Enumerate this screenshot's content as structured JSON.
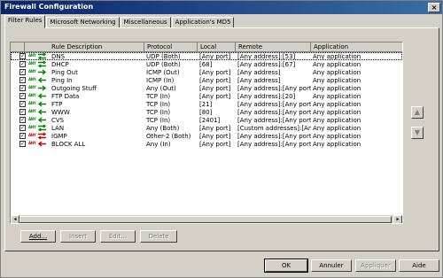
{
  "window": {
    "title": "Firewall Configuration",
    "close_glyph": "×"
  },
  "tabs": [
    {
      "label": "Filter Rules",
      "active": true
    },
    {
      "label": "Microsoft Networking",
      "active": false
    },
    {
      "label": "Miscellaneous",
      "active": false
    },
    {
      "label": "Application's MD5",
      "active": false
    }
  ],
  "columns": [
    "Rule Description",
    "Protocol",
    "Local",
    "Remote",
    "Application"
  ],
  "rules": [
    {
      "enabled": true,
      "dir": "both",
      "desc": "DNS",
      "protocol": "UDP (Both)",
      "local": "[Any port]",
      "remote": "[Any address]:[53]",
      "app": "Any application",
      "selected": true
    },
    {
      "enabled": true,
      "dir": "both",
      "desc": "DHCP",
      "protocol": "UDP (Both)",
      "local": "[68]",
      "remote": "[Any address]:[67]",
      "app": "Any application"
    },
    {
      "enabled": true,
      "dir": "out",
      "desc": "Ping Out",
      "protocol": "ICMP (Out)",
      "local": "[Any port]",
      "remote": "[Any address]",
      "app": "Any application"
    },
    {
      "enabled": true,
      "dir": "in",
      "desc": "Ping In",
      "protocol": "ICMP (In)",
      "local": "[Any port]",
      "remote": "[Any address]",
      "app": "Any application"
    },
    {
      "enabled": true,
      "dir": "out",
      "desc": "Outgoing Stuff",
      "protocol": "Any (Out)",
      "local": "[Any port]",
      "remote": "[Any address]:[Any port]",
      "app": "Any application"
    },
    {
      "enabled": true,
      "dir": "in",
      "desc": "FTP Data",
      "protocol": "TCP (In)",
      "local": "[Any port]",
      "remote": "[Any address]:[20]",
      "app": "Any application"
    },
    {
      "enabled": true,
      "dir": "in",
      "desc": "FTP",
      "protocol": "TCP (In)",
      "local": "[21]",
      "remote": "[Any address]:[Any port]",
      "app": "Any application"
    },
    {
      "enabled": true,
      "dir": "in",
      "desc": "WWW",
      "protocol": "TCP (In)",
      "local": "[80]",
      "remote": "[Any address]:[Any port]",
      "app": "Any application"
    },
    {
      "enabled": true,
      "dir": "in",
      "desc": "CVS",
      "protocol": "TCP (In)",
      "local": "[2401]",
      "remote": "[Any address]:[Any port]",
      "app": "Any application"
    },
    {
      "enabled": true,
      "dir": "both",
      "desc": "LAN",
      "protocol": "Any (Both)",
      "local": "[Any port]",
      "remote": "[Custom addresses]:[Any port]",
      "app": "Any application"
    },
    {
      "enabled": true,
      "dir": "block-both",
      "desc": "IGMP",
      "protocol": "Other-2 (Both)",
      "local": "[Any port]",
      "remote": "[Any address]:[Any port]",
      "app": "Any application"
    },
    {
      "enabled": true,
      "dir": "block-in",
      "desc": "BLOCK ALL",
      "protocol": "Any (In)",
      "local": "[Any port]",
      "remote": "[Any address]:[Any port]",
      "app": "Any application"
    }
  ],
  "any_tag": "ANY",
  "list_actions": {
    "add": "Add...",
    "insert": "Insert",
    "edit": "Edit...",
    "delete": "Delete"
  },
  "dialog_buttons": {
    "ok": "OK",
    "cancel": "Annuler",
    "apply": "Appliquer",
    "help": "Aide"
  },
  "colors": {
    "allow": "#008800",
    "block": "#cc0000",
    "titlebar": "#0a246a"
  }
}
